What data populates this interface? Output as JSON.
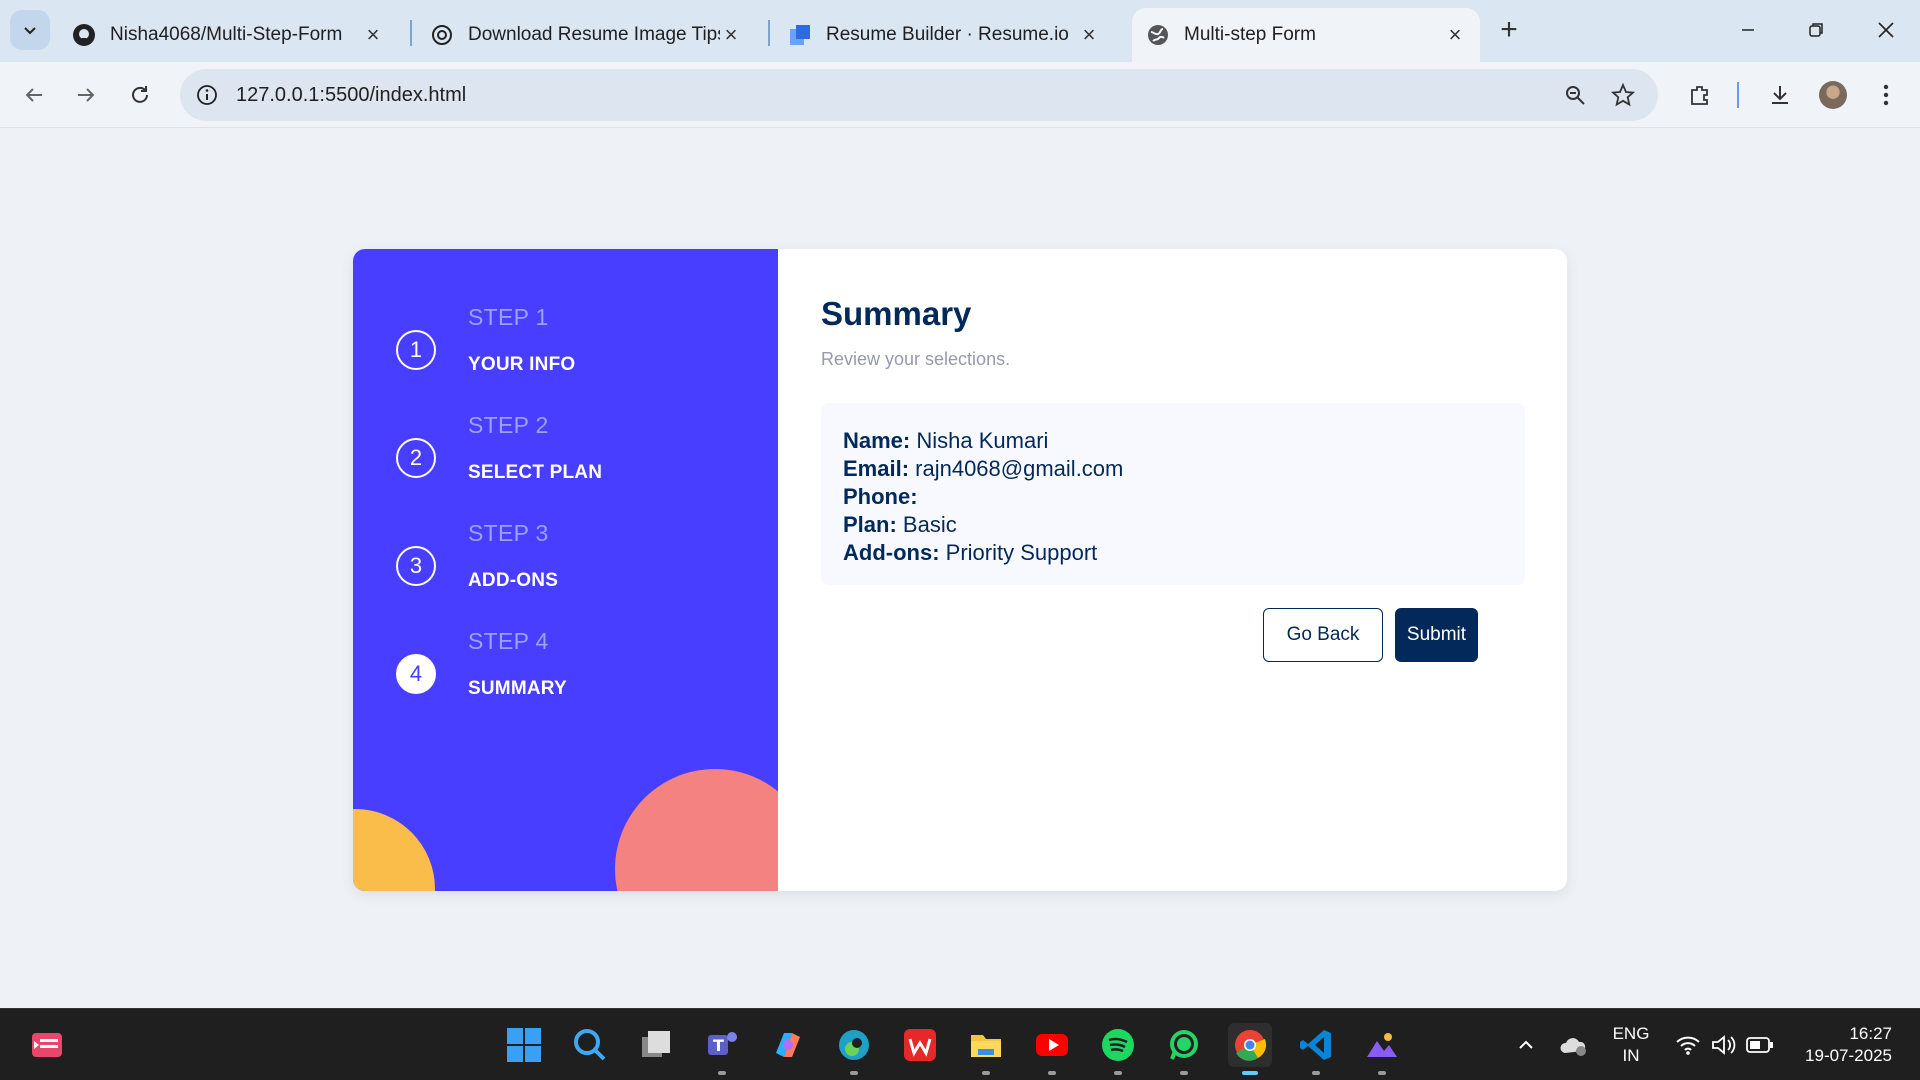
{
  "browser": {
    "tabs": [
      {
        "title": "Nisha4068/Multi-Step-Form",
        "icon": "github-icon"
      },
      {
        "title": "Download Resume Image Tips",
        "icon": "chatgpt-icon"
      },
      {
        "title": "Resume Builder · Resume.io",
        "icon": "resumeio-icon"
      },
      {
        "title": "Multi-step Form",
        "icon": "globe-icon",
        "active": true
      }
    ],
    "url": "127.0.0.1:5500/index.html"
  },
  "sidebar": {
    "steps": [
      {
        "number": "1",
        "label": "STEP 1",
        "name": "YOUR INFO"
      },
      {
        "number": "2",
        "label": "STEP 2",
        "name": "SELECT PLAN"
      },
      {
        "number": "3",
        "label": "STEP 3",
        "name": "ADD-ONS"
      },
      {
        "number": "4",
        "label": "STEP 4",
        "name": "SUMMARY",
        "active": true
      }
    ]
  },
  "main": {
    "title": "Summary",
    "subtitle": "Review your selections.",
    "summary": {
      "name_label": "Name:",
      "name_value": "Nisha Kumari",
      "email_label": "Email:",
      "email_value": "rajn4068@gmail.com",
      "phone_label": "Phone:",
      "phone_value": "",
      "plan_label": "Plan:",
      "plan_value": "Basic",
      "addons_label": "Add-ons:",
      "addons_value": "Priority Support"
    },
    "back_label": "Go Back",
    "submit_label": "Submit"
  },
  "taskbar": {
    "language": "ENG",
    "region": "IN",
    "time": "16:27",
    "date": "19-07-2025"
  },
  "colors": {
    "sidebar_bg": "#483eff",
    "accent_dark": "#02295a",
    "blob_orange": "#fbbd4a",
    "blob_pink": "#f38280"
  }
}
